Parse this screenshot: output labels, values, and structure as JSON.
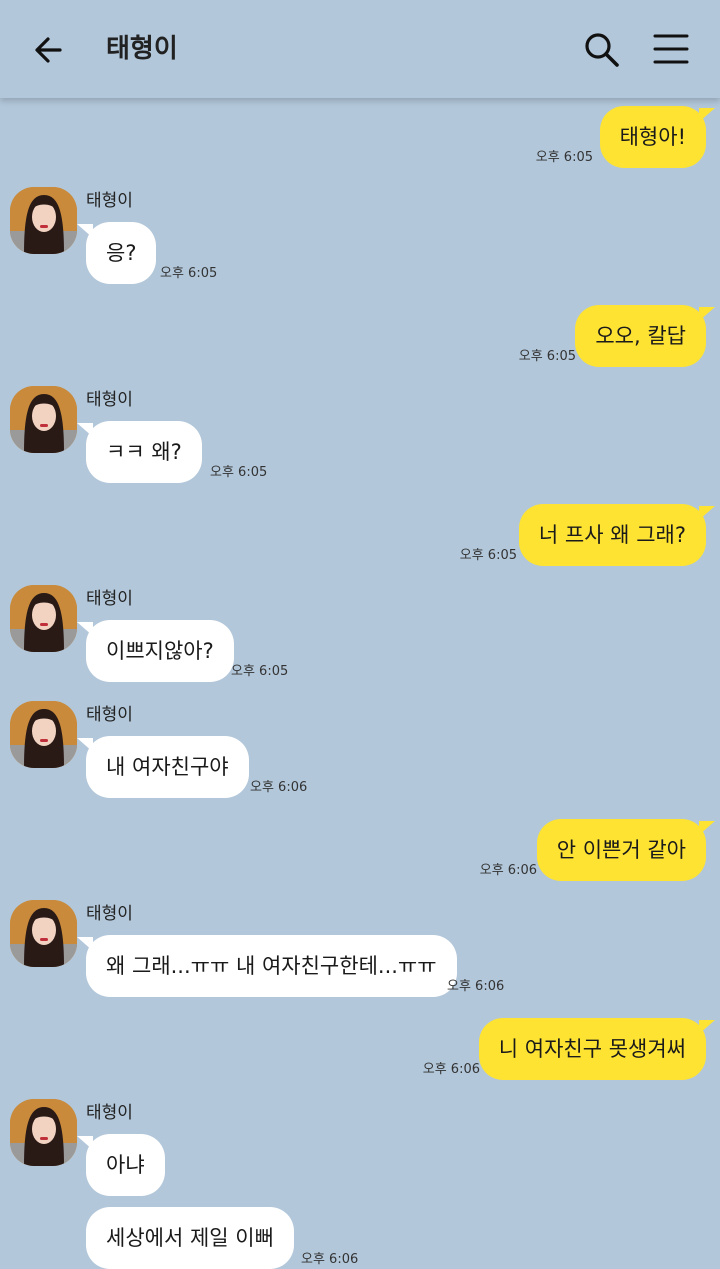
{
  "header": {
    "title": "태형이"
  },
  "messages": [
    {
      "from": "me",
      "text": "태형아!",
      "time": "오후 6:05"
    },
    {
      "from": "them",
      "sender": "태형이",
      "text": "응?",
      "time": "오후 6:05"
    },
    {
      "from": "me",
      "text": "오오, 칼답",
      "time": "오후 6:05"
    },
    {
      "from": "them",
      "sender": "태형이",
      "text": "ㅋㅋ 왜?",
      "time": "오후 6:05"
    },
    {
      "from": "me",
      "text": "너 프사 왜 그래?",
      "time": "오후 6:05"
    },
    {
      "from": "them",
      "sender": "태형이",
      "text": "이쁘지않아?",
      "time": "오후 6:05"
    },
    {
      "from": "them",
      "sender": "태형이",
      "text": "내 여자친구야",
      "time": "오후 6:06"
    },
    {
      "from": "me",
      "text": "안 이쁜거 같아",
      "time": "오후 6:06"
    },
    {
      "from": "them",
      "sender": "태형이",
      "text": "왜 그래...ㅠㅠ 내 여자친구한테...ㅠㅠ",
      "time": "오후 6:06"
    },
    {
      "from": "me",
      "text": "니 여자친구 못생겨써",
      "time": "오후 6:06"
    },
    {
      "from": "them",
      "sender": "태형이",
      "text": "아냐",
      "time": ""
    },
    {
      "from": "them",
      "sender": "",
      "text": "세상에서 제일 이뻐",
      "time": "오후 6:06"
    }
  ],
  "colors": {
    "background": "#b2c7da",
    "my_bubble": "#fee333",
    "their_bubble": "#ffffff"
  },
  "icons": {
    "back": "arrow-left-icon",
    "search": "search-icon",
    "menu": "hamburger-menu-icon"
  }
}
